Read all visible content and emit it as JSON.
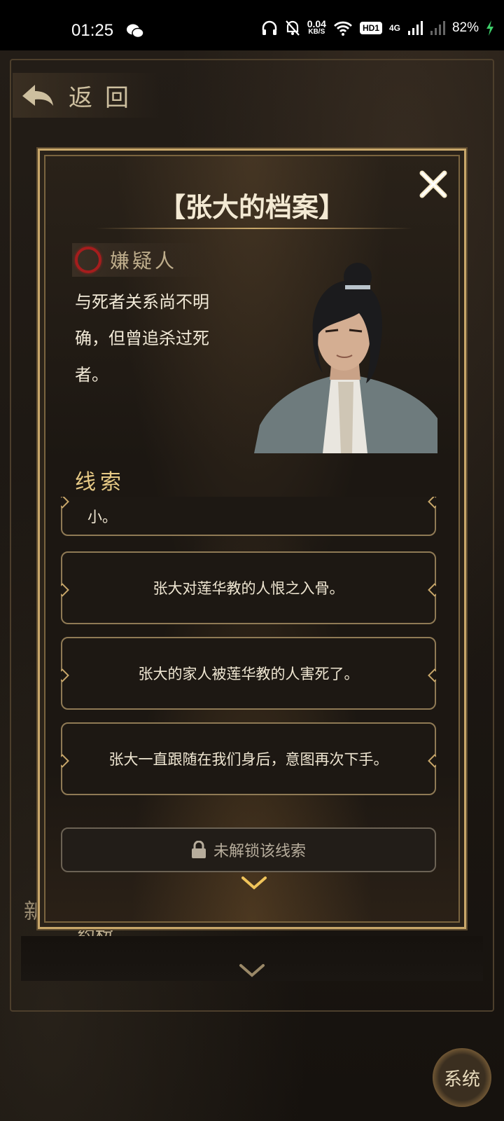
{
  "status_bar": {
    "time": "01:25",
    "speed_value": "0.04",
    "speed_unit": "KB/S",
    "hd_label": "HD1",
    "network": "4G",
    "battery": "82%"
  },
  "background": {
    "back_label": "返回",
    "side_tab": "新",
    "item_text": "药粉",
    "system_button": "系统"
  },
  "modal": {
    "title": "【张大的档案】",
    "tag": "嫌疑人",
    "description": "与死者关系尚不明确，但曾追杀过死者。",
    "clue_heading": "线索",
    "clues": [
      "小。",
      "张大对莲华教的人恨之入骨。",
      "张大的家人被莲华教的人害死了。",
      "张大一直跟随在我们身后，意图再次下手。"
    ],
    "locked_label": "未解锁该线索"
  },
  "colors": {
    "accent_gold": "#c8a76a",
    "suspect_red": "#a51d1d",
    "clue_heading": "#e6c985"
  }
}
